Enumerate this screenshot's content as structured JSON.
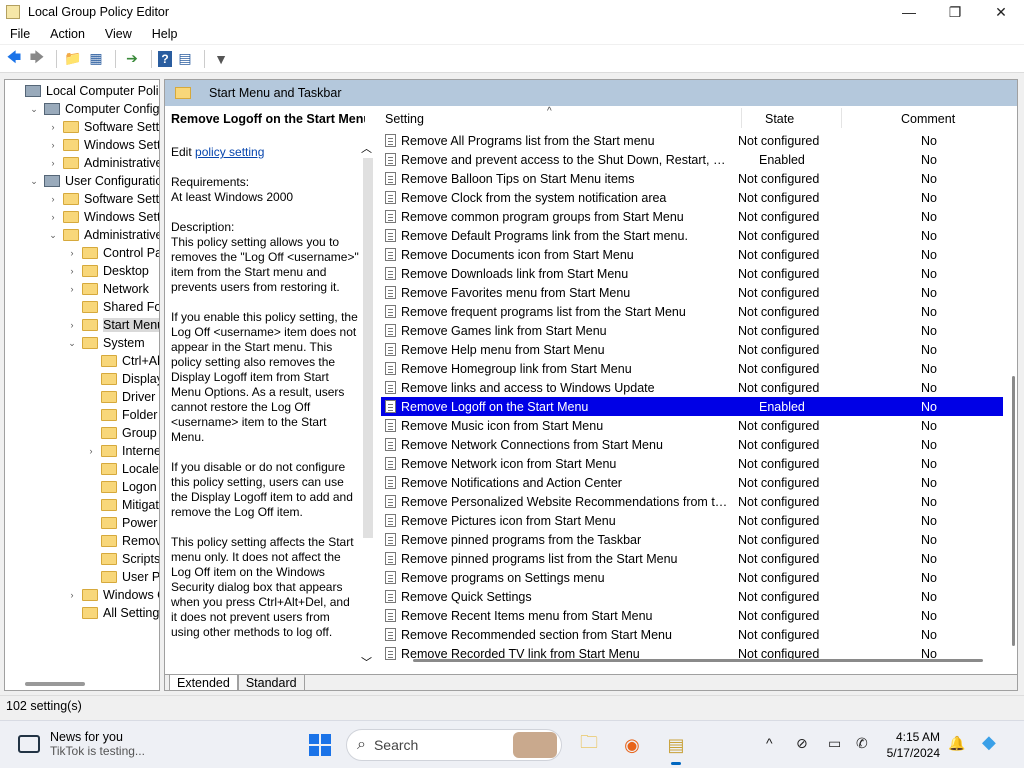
{
  "window": {
    "title": "Local Group Policy Editor",
    "minimize": "—",
    "maximize": "❐",
    "close": "✕"
  },
  "menu": [
    "File",
    "Action",
    "View",
    "Help"
  ],
  "toolbar": {
    "back": "🡄",
    "forward": "🡆",
    "up": "📁",
    "show_hide": "▦",
    "export": "➔",
    "help": "?",
    "properties": "▤",
    "filter": "▼"
  },
  "tree": [
    {
      "label": "Local Computer Policy",
      "indent": 0,
      "exp": "",
      "icon": "comp"
    },
    {
      "label": "Computer Configura",
      "indent": 1,
      "exp": "⌄",
      "icon": "comp"
    },
    {
      "label": "Software Settings",
      "indent": 2,
      "exp": "›",
      "icon": "folder"
    },
    {
      "label": "Windows Setting",
      "indent": 2,
      "exp": "›",
      "icon": "folder"
    },
    {
      "label": "Administrative Te",
      "indent": 2,
      "exp": "›",
      "icon": "folder"
    },
    {
      "label": "User Configuration",
      "indent": 1,
      "exp": "⌄",
      "icon": "comp"
    },
    {
      "label": "Software Settings",
      "indent": 2,
      "exp": "›",
      "icon": "folder"
    },
    {
      "label": "Windows Setting",
      "indent": 2,
      "exp": "›",
      "icon": "folder"
    },
    {
      "label": "Administrative Te",
      "indent": 2,
      "exp": "⌄",
      "icon": "folder"
    },
    {
      "label": "Control Panel",
      "indent": 3,
      "exp": "›",
      "icon": "folder"
    },
    {
      "label": "Desktop",
      "indent": 3,
      "exp": "›",
      "icon": "folder"
    },
    {
      "label": "Network",
      "indent": 3,
      "exp": "›",
      "icon": "folder"
    },
    {
      "label": "Shared Folder",
      "indent": 3,
      "exp": "",
      "icon": "folder"
    },
    {
      "label": "Start Menu ar",
      "indent": 3,
      "exp": "›",
      "icon": "folder",
      "selected": true
    },
    {
      "label": "System",
      "indent": 3,
      "exp": "⌄",
      "icon": "folder"
    },
    {
      "label": "Ctrl+Alt+I",
      "indent": 4,
      "exp": "",
      "icon": "folder"
    },
    {
      "label": "Display",
      "indent": 4,
      "exp": "",
      "icon": "folder"
    },
    {
      "label": "Driver Inst",
      "indent": 4,
      "exp": "",
      "icon": "folder"
    },
    {
      "label": "Folder Red",
      "indent": 4,
      "exp": "",
      "icon": "folder"
    },
    {
      "label": "Group Pol",
      "indent": 4,
      "exp": "",
      "icon": "folder"
    },
    {
      "label": "Internet C",
      "indent": 4,
      "exp": "›",
      "icon": "folder"
    },
    {
      "label": "Locale Ser",
      "indent": 4,
      "exp": "",
      "icon": "folder"
    },
    {
      "label": "Logon",
      "indent": 4,
      "exp": "",
      "icon": "folder"
    },
    {
      "label": "Mitigation",
      "indent": 4,
      "exp": "",
      "icon": "folder"
    },
    {
      "label": "Power Ma",
      "indent": 4,
      "exp": "",
      "icon": "folder"
    },
    {
      "label": "Removabl",
      "indent": 4,
      "exp": "",
      "icon": "folder"
    },
    {
      "label": "Scripts",
      "indent": 4,
      "exp": "",
      "icon": "folder"
    },
    {
      "label": "User Profi",
      "indent": 4,
      "exp": "",
      "icon": "folder"
    },
    {
      "label": "Windows Cor",
      "indent": 3,
      "exp": "›",
      "icon": "folder"
    },
    {
      "label": "All Settings",
      "indent": 3,
      "exp": "",
      "icon": "folder"
    }
  ],
  "pane": {
    "header": "Start Menu and Taskbar",
    "desc_title": "Remove Logoff on the Start Menu",
    "edit_prefix": "Edit ",
    "edit_link": "policy setting",
    "req_label": "Requirements:",
    "req_value": "At least Windows 2000",
    "desc_label": "Description:",
    "desc_p1": "This policy setting allows you to removes the \"Log Off <username>\" item from the Start menu and prevents users from restoring it.",
    "desc_p2": "If you enable this policy setting, the Log Off <username> item does not appear in the Start menu. This policy setting also removes the Display Logoff item from Start Menu Options. As a result, users cannot restore the Log Off <username> item to the Start Menu.",
    "desc_p3": "If you disable or do not configure this policy setting, users can use the Display Logoff item to add and remove the Log Off item.",
    "desc_p4": "This policy setting affects the Start menu only. It does not affect the Log Off item on the Windows Security dialog box that appears when you press Ctrl+Alt+Del, and it does not prevent users from using other methods to log off."
  },
  "columns": {
    "setting": "Setting",
    "state": "State",
    "comment": "Comment"
  },
  "rows": [
    {
      "name": "Remove All Programs list from the Start menu",
      "state": "Not configured",
      "comment": "No"
    },
    {
      "name": "Remove and prevent access to the Shut Down, Restart, Sleep...",
      "state": "Enabled",
      "comment": "No"
    },
    {
      "name": "Remove Balloon Tips on Start Menu items",
      "state": "Not configured",
      "comment": "No"
    },
    {
      "name": "Remove Clock from the system notification area",
      "state": "Not configured",
      "comment": "No"
    },
    {
      "name": "Remove common program groups from Start Menu",
      "state": "Not configured",
      "comment": "No"
    },
    {
      "name": "Remove Default Programs link from the Start menu.",
      "state": "Not configured",
      "comment": "No"
    },
    {
      "name": "Remove Documents icon from Start Menu",
      "state": "Not configured",
      "comment": "No"
    },
    {
      "name": "Remove Downloads link from Start Menu",
      "state": "Not configured",
      "comment": "No"
    },
    {
      "name": "Remove Favorites menu from Start Menu",
      "state": "Not configured",
      "comment": "No"
    },
    {
      "name": "Remove frequent programs list from the Start Menu",
      "state": "Not configured",
      "comment": "No"
    },
    {
      "name": "Remove Games link from Start Menu",
      "state": "Not configured",
      "comment": "No"
    },
    {
      "name": "Remove Help menu from Start Menu",
      "state": "Not configured",
      "comment": "No"
    },
    {
      "name": "Remove Homegroup link from Start Menu",
      "state": "Not configured",
      "comment": "No"
    },
    {
      "name": "Remove links and access to Windows Update",
      "state": "Not configured",
      "comment": "No"
    },
    {
      "name": "Remove Logoff on the Start Menu",
      "state": "Enabled",
      "comment": "No",
      "selected": true
    },
    {
      "name": "Remove Music icon from Start Menu",
      "state": "Not configured",
      "comment": "No"
    },
    {
      "name": "Remove Network Connections from Start Menu",
      "state": "Not configured",
      "comment": "No"
    },
    {
      "name": "Remove Network icon from Start Menu",
      "state": "Not configured",
      "comment": "No"
    },
    {
      "name": "Remove Notifications and Action Center",
      "state": "Not configured",
      "comment": "No"
    },
    {
      "name": "Remove Personalized Website Recommendations from the ...",
      "state": "Not configured",
      "comment": "No"
    },
    {
      "name": "Remove Pictures icon from Start Menu",
      "state": "Not configured",
      "comment": "No"
    },
    {
      "name": "Remove pinned programs from the Taskbar",
      "state": "Not configured",
      "comment": "No"
    },
    {
      "name": "Remove pinned programs list from the Start Menu",
      "state": "Not configured",
      "comment": "No"
    },
    {
      "name": "Remove programs on Settings menu",
      "state": "Not configured",
      "comment": "No"
    },
    {
      "name": "Remove Quick Settings",
      "state": "Not configured",
      "comment": "No"
    },
    {
      "name": "Remove Recent Items menu from Start Menu",
      "state": "Not configured",
      "comment": "No"
    },
    {
      "name": "Remove Recommended section from Start Menu",
      "state": "Not configured",
      "comment": "No"
    },
    {
      "name": "Remove Recorded TV link from Start Menu",
      "state": "Not configured",
      "comment": "No"
    }
  ],
  "tabs": {
    "extended": "Extended",
    "standard": "Standard"
  },
  "status": "102 setting(s)",
  "taskbar": {
    "news_title": "News for you",
    "news_sub": "TikTok is testing...",
    "search_icon": "⌕",
    "search_placeholder": "Search",
    "explorer_icon": "🗀",
    "firefox_icon": "◉",
    "notepad_icon": "▤",
    "tray_chevron": "^",
    "tray_network": "⊘",
    "tray_display": "▭",
    "tray_focus": "✆",
    "tray_bell": "🔔",
    "tray_copilot": "◆",
    "time": "4:15 AM",
    "date": "5/17/2024"
  },
  "colors": {
    "selection": "#0000e6",
    "header_bar": "#b4c8dc",
    "link": "#0645ad"
  }
}
